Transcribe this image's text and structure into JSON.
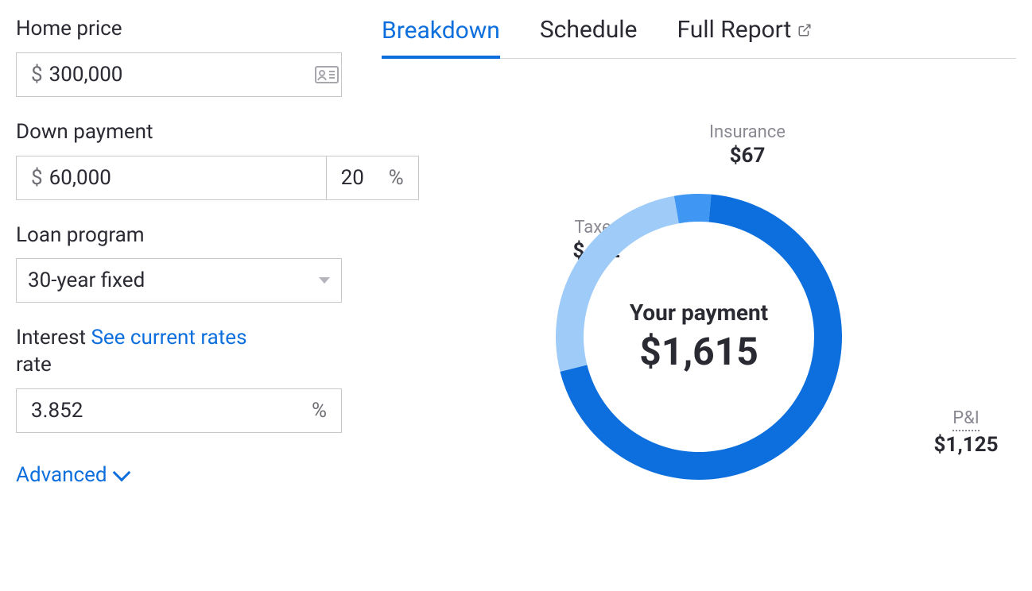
{
  "form": {
    "homePrice": {
      "label": "Home price",
      "prefix": "$",
      "value": "300,000"
    },
    "downPayment": {
      "label": "Down payment",
      "amountPrefix": "$",
      "amountValue": "60,000",
      "pctValue": "20",
      "pctSuffix": "%"
    },
    "loanProgram": {
      "label": "Loan program",
      "value": "30-year fixed"
    },
    "interest": {
      "label": "Interest rate",
      "linkText": "See current rates",
      "value": "3.852",
      "suffix": "%"
    },
    "advanced": "Advanced"
  },
  "tabs": {
    "breakdown": "Breakdown",
    "schedule": "Schedule",
    "fullReport": "Full Report"
  },
  "chart_data": {
    "type": "pie",
    "title": "Your payment",
    "total": "$1,615",
    "series": [
      {
        "name": "P&I",
        "label": "P&I",
        "value": 1125,
        "display": "$1,125",
        "color": "#0d6fdd"
      },
      {
        "name": "Taxes",
        "label": "Taxes",
        "value": 422,
        "display": "$422",
        "color": "#9ecbf7"
      },
      {
        "name": "Insurance",
        "label": "Insurance",
        "value": 67,
        "display": "$67",
        "color": "#3f97f3"
      }
    ]
  }
}
